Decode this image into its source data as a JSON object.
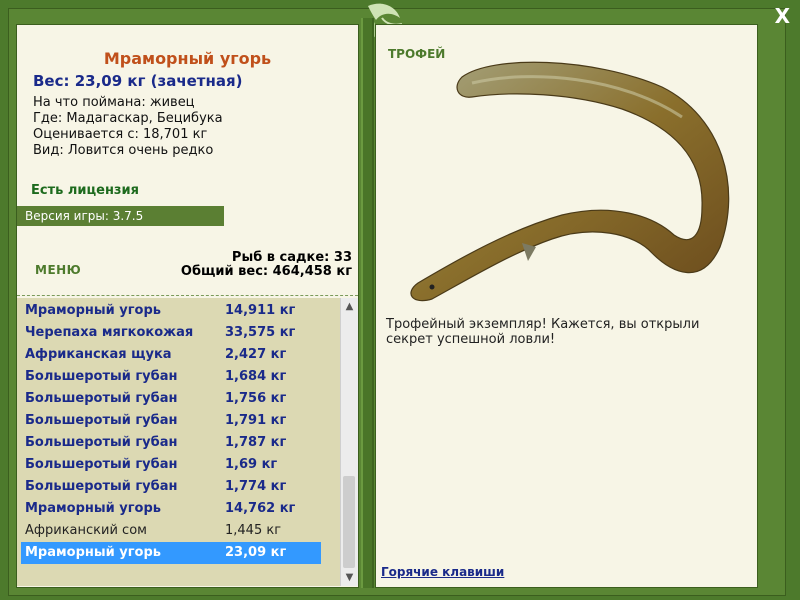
{
  "window": {
    "close_label": "X"
  },
  "fish": {
    "name": "Мраморный угорь",
    "weight_line": "Вес: 23,09 кг (зачетная)",
    "caught_on": "На что поймана: живец",
    "location": "Где: Мадагаскар, Бецибука",
    "valued_from": "Оценивается с: 18,701 кг",
    "rarity": "Вид: Ловится очень редко"
  },
  "license": "Есть лицензия",
  "version": "Версия игры: 3.7.5",
  "menu_label": "МЕНЮ",
  "stats": {
    "fish_in_keepnet": "Рыб в садке: 33",
    "total_weight": "Общий вес: 464,458 кг"
  },
  "catch_list": [
    {
      "name": "Мраморный угорь",
      "weight": "14,911 кг",
      "style": "bold"
    },
    {
      "name": "Черепаха мягкокожая",
      "weight": "33,575 кг",
      "style": "bold"
    },
    {
      "name": "Африканская щука",
      "weight": "2,427 кг",
      "style": "bold"
    },
    {
      "name": "Большеротый губан",
      "weight": "1,684 кг",
      "style": "bold"
    },
    {
      "name": "Большеротый губан",
      "weight": "1,756 кг",
      "style": "bold"
    },
    {
      "name": "Большеротый губан",
      "weight": "1,791 кг",
      "style": "bold"
    },
    {
      "name": "Большеротый губан",
      "weight": "1,787 кг",
      "style": "bold"
    },
    {
      "name": "Большеротый губан",
      "weight": "1,69 кг",
      "style": "bold"
    },
    {
      "name": "Большеротый губан",
      "weight": "1,774 кг",
      "style": "bold"
    },
    {
      "name": "Мраморный угорь",
      "weight": "14,762 кг",
      "style": "bold"
    },
    {
      "name": "Африканский сом",
      "weight": "1,445 кг",
      "style": "plain"
    },
    {
      "name": "Мраморный угорь",
      "weight": "23,09 кг",
      "style": "sel"
    }
  ],
  "trophy_label": "ТРОФЕЙ",
  "trophy_text": "Трофейный экземпляр! Кажется, вы открыли секрет успешной ловли!",
  "hotkeys": "Горячие клавиши",
  "colors": {
    "frame": "#4d7a2c",
    "panel": "#f7f5e6",
    "highlight": "#3399ff",
    "title": "#c0501b",
    "accent_blue": "#1a2a8a"
  },
  "icons": [
    "close-icon",
    "leaf-logo-icon",
    "scroll-up-icon",
    "scroll-down-icon"
  ]
}
